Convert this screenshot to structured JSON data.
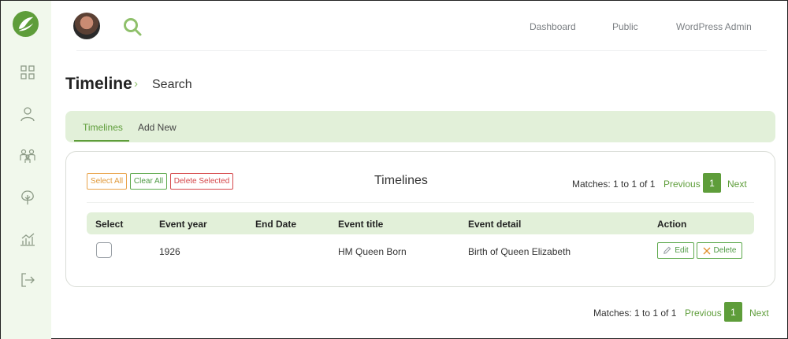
{
  "topnav": {
    "dashboard": "Dashboard",
    "public": "Public",
    "wp_admin": "WordPress Admin"
  },
  "header": {
    "title": "Timeline",
    "breadcrumb": "Search"
  },
  "tabs": [
    {
      "label": "Timelines",
      "active": true
    },
    {
      "label": "Add New",
      "active": false
    }
  ],
  "toolbar": {
    "select_all": "Select All",
    "clear_all": "Clear All",
    "delete_selected": "Delete Selected"
  },
  "card": {
    "title": "Timelines"
  },
  "pagination": {
    "matches": "Matches: 1 to 1 of 1",
    "previous": "Previous",
    "current": "1",
    "next": "Next"
  },
  "table": {
    "columns": [
      "Select",
      "Event year",
      "End Date",
      "Event title",
      "Event detail",
      "Action"
    ],
    "rows": [
      {
        "event_year": "1926",
        "end_date": "",
        "event_title": "HM Queen Born",
        "event_detail": "Birth of Queen Elizabeth",
        "edit_label": "Edit",
        "delete_label": "Delete"
      }
    ]
  },
  "colors": {
    "accent": "#5e9d3a",
    "sidebar_bg": "#f1f8ec",
    "tab_bg": "#e2f0d9",
    "danger": "#d5484b",
    "warning": "#e9a34a"
  },
  "icons": {
    "logo": "leaf-logo-icon",
    "search": "search-icon",
    "sidebar": [
      "dashboard-grid-icon",
      "user-icon",
      "users-group-icon",
      "tree-icon",
      "chart-icon",
      "logout-icon"
    ]
  }
}
